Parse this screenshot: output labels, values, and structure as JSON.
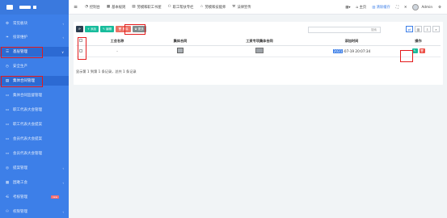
{
  "sidebar": {
    "items": [
      {
        "label": "常见板块",
        "icon": "user-cog-icon",
        "arrow": "‹"
      },
      {
        "label": "投诉维护",
        "icon": "leaf-icon",
        "arrow": "‹"
      },
      {
        "label": "基层管理",
        "icon": "list-icon",
        "arrow": "∨"
      },
      {
        "label": "安全生产",
        "icon": "clock-icon"
      },
      {
        "label": "集体合同管理",
        "icon": "book-icon"
      },
      {
        "label": "集体合同监督管理",
        "icon": "doc-icon"
      },
      {
        "label": "职工代表大会管理",
        "icon": "doc-icon"
      },
      {
        "label": "职工代表大会提案",
        "icon": "doc-icon"
      },
      {
        "label": "会员代表大会提案",
        "icon": "doc-icon"
      },
      {
        "label": "会员代表大会管理",
        "icon": "doc-icon"
      },
      {
        "label": "提案管理",
        "icon": "globe-icon",
        "arrow": "‹"
      },
      {
        "label": "困难工会",
        "icon": "grid-icon",
        "arrow": "‹"
      },
      {
        "label": "考核管理",
        "icon": "share-icon",
        "badge": "new"
      },
      {
        "label": "权限管理",
        "icon": "users-icon",
        "arrow": "‹"
      }
    ]
  },
  "header": {
    "nav": [
      {
        "label": "控制台",
        "icon": "dashboard-icon"
      },
      {
        "label": "基本规则",
        "icon": "table-icon"
      },
      {
        "label": "劳模和职工书屋",
        "icon": "book-icon"
      },
      {
        "label": "职工帮扶专栏",
        "icon": "users-icon"
      },
      {
        "label": "劳模和技能师",
        "icon": "star-icon"
      },
      {
        "label": "法律宣传",
        "icon": "gavel-icon"
      }
    ],
    "home": "主页",
    "clear_cache": "清除缓存",
    "user": "Admin"
  },
  "toolbar": {
    "refresh": "⟳",
    "add": "+ 添加",
    "edit": "✎ 编辑",
    "delete": "🗑 删除",
    "more": "✿ 更多"
  },
  "search": {
    "placeholder": "搜索"
  },
  "table": {
    "columns": [
      "工会名称",
      "集体合同",
      "工资专项集体合同",
      "添加时间",
      "操作"
    ],
    "rows": [
      {
        "union": "-",
        "time_hl": "2021",
        "time_rest": "-07-19 20:07:34"
      }
    ]
  },
  "footer": {
    "text": "显示第 1 到第 1 条记录，总共 1 条记录"
  }
}
